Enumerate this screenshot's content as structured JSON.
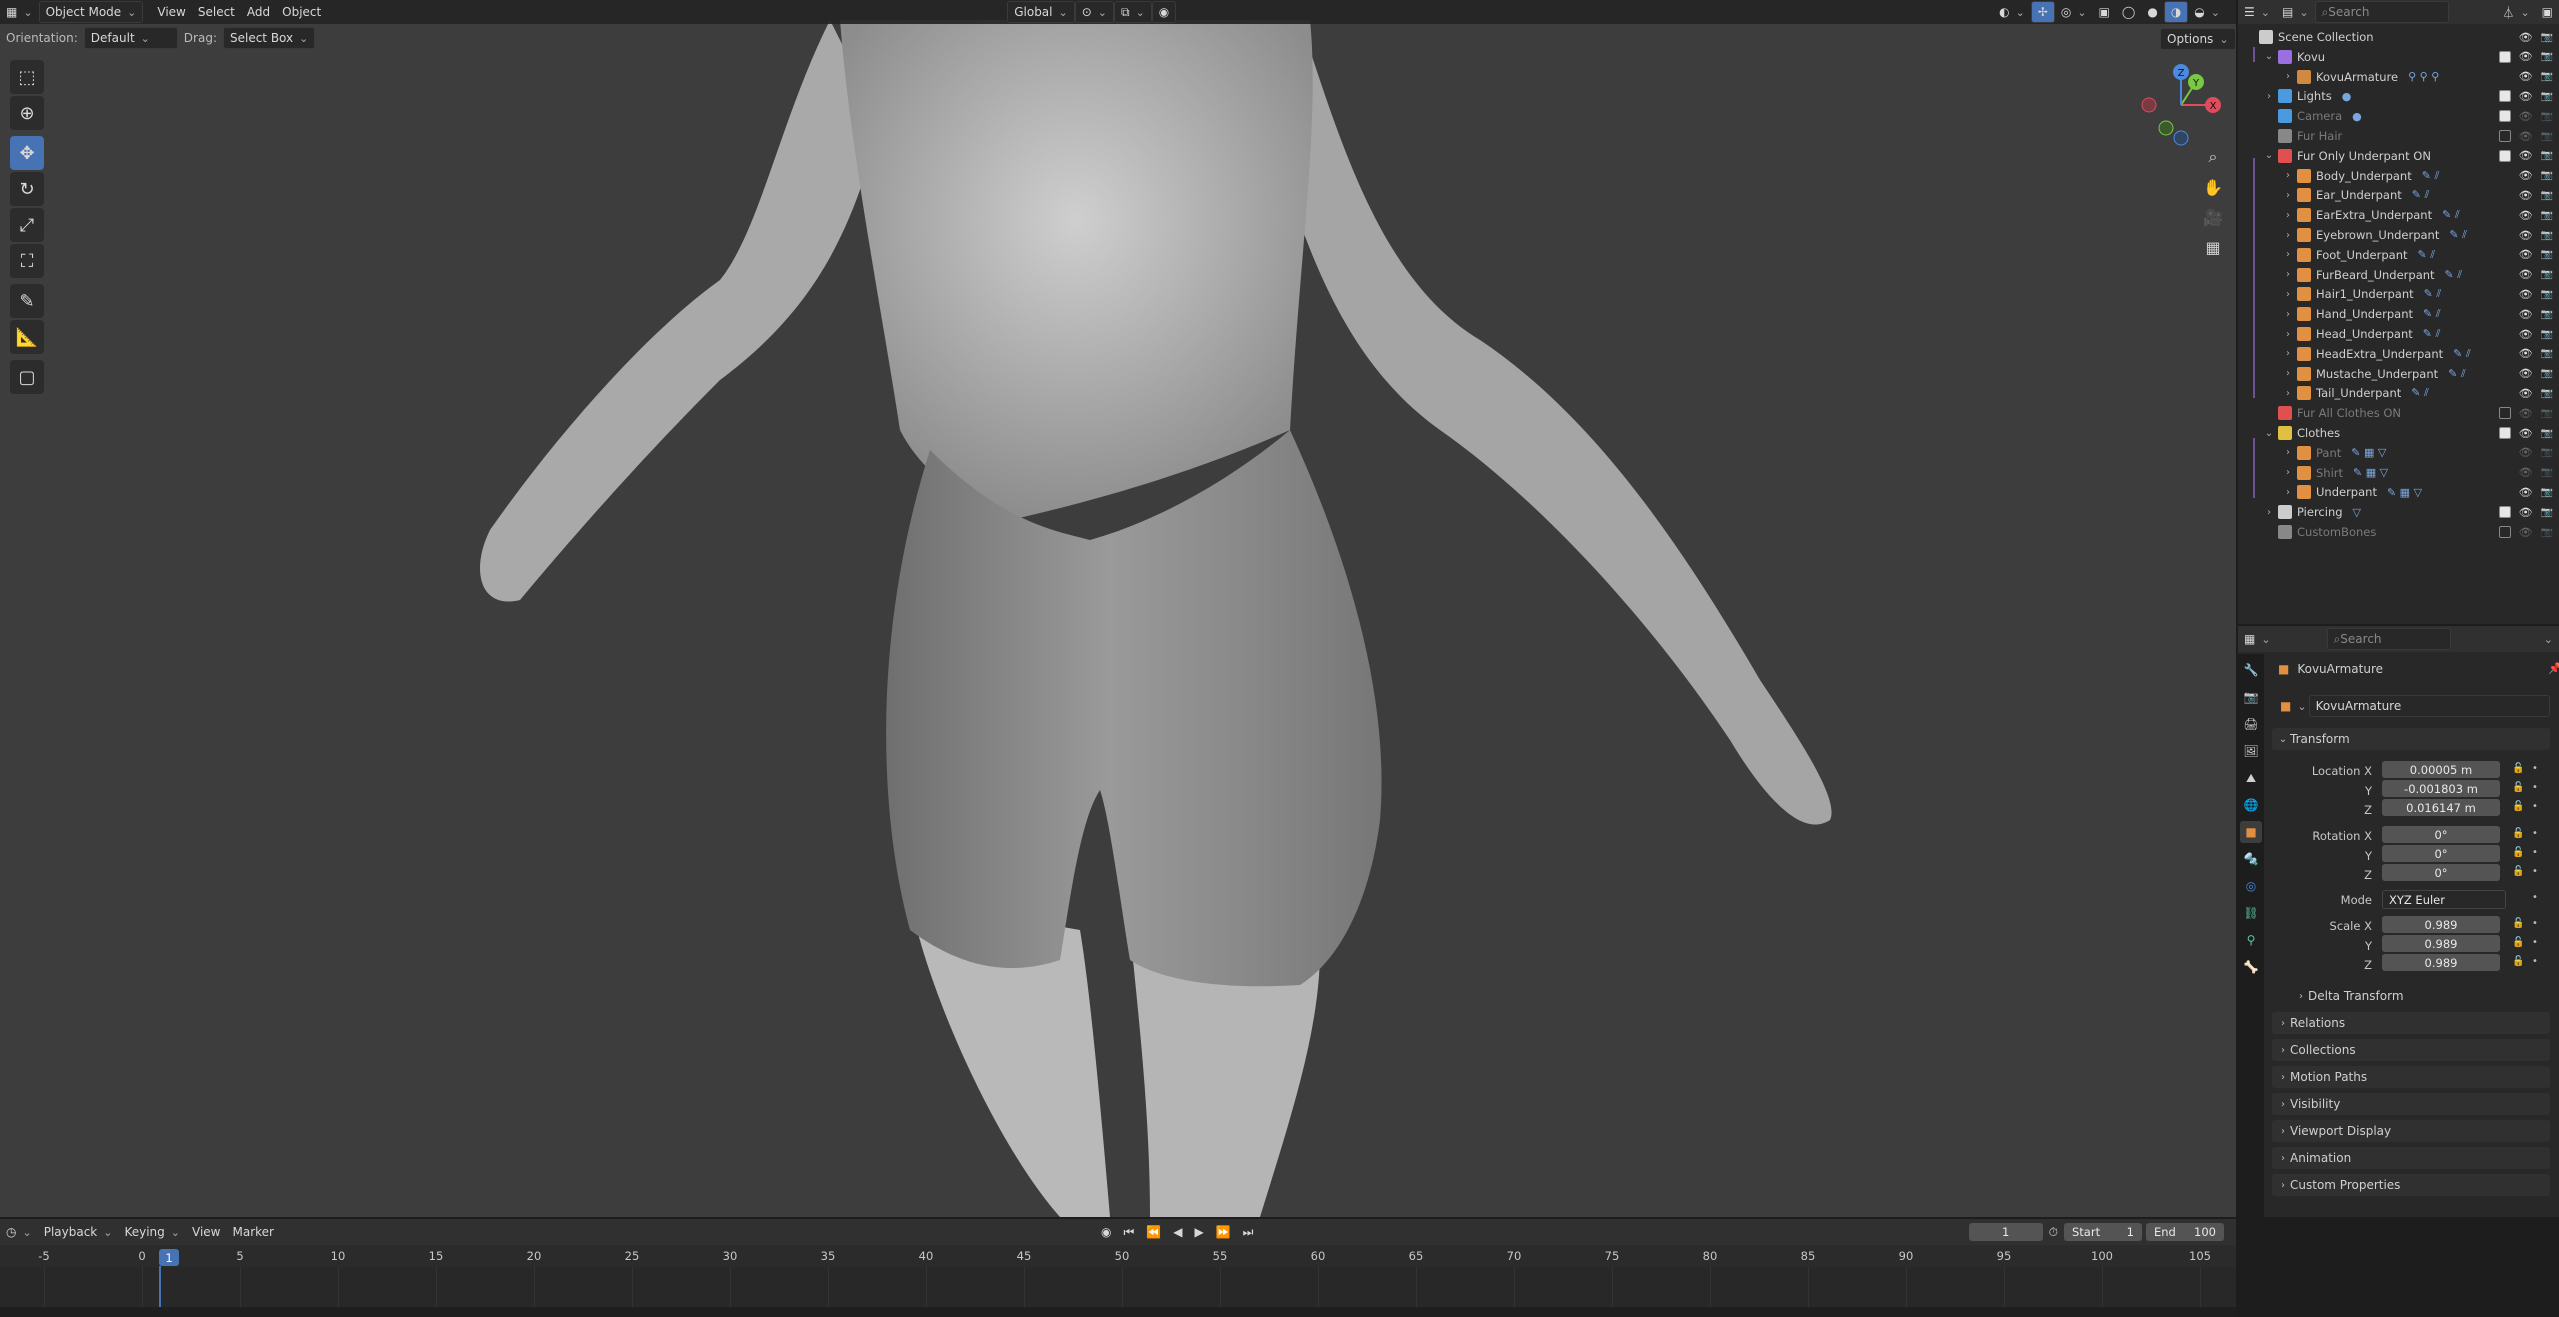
{
  "header": {
    "editor_icon": "editor-type-icon",
    "mode": "Object Mode",
    "menus": [
      "View",
      "Select",
      "Add",
      "Object"
    ],
    "transform_orientation": "Global",
    "orientation_label": "Orientation:",
    "orientation_value": "Default",
    "drag_label": "Drag:",
    "drag_value": "Select Box",
    "options_label": "Options"
  },
  "toolbar": [
    "select-box-icon",
    "cursor-icon",
    "move-icon",
    "rotate-icon",
    "scale-icon",
    "transform-icon",
    "annotate-icon",
    "measure-icon",
    "add-cube-icon"
  ],
  "gizmo": {
    "x": "X",
    "y": "Y",
    "z": "Z"
  },
  "outliner": {
    "search_placeholder": "Search",
    "rows": [
      {
        "label": "Scene Collection",
        "depth": 0,
        "icon_color": "#cccccc",
        "arrow": "",
        "checkbox": "none"
      },
      {
        "label": "Kovu",
        "depth": 1,
        "icon_color": "#9b6fe0",
        "arrow": "⌄",
        "checkbox": "on"
      },
      {
        "label": "KovuArmature",
        "depth": 2,
        "icon_color": "#d08a40",
        "arrow": "›",
        "checkbox": "none",
        "extra": "⚲ ⚲ ⚲"
      },
      {
        "label": "Lights",
        "depth": 1,
        "icon_color": "#4a9ae0",
        "arrow": "›",
        "checkbox": "on",
        "extra": "●"
      },
      {
        "label": "Camera",
        "depth": 1,
        "icon_color": "#4a9ae0",
        "arrow": "",
        "checkbox": "on",
        "extra": "●",
        "dim": true
      },
      {
        "label": "Fur Hair",
        "depth": 1,
        "icon_color": "#888888",
        "arrow": "",
        "checkbox": "off",
        "dim": true
      },
      {
        "label": "Fur Only Underpant ON",
        "depth": 1,
        "icon_color": "#e05050",
        "arrow": "⌄",
        "checkbox": "on"
      },
      {
        "label": "Body_Underpant",
        "depth": 2,
        "icon_color": "#e09040",
        "arrow": "›",
        "checkbox": "none",
        "extra": "✎ ⫽"
      },
      {
        "label": "Ear_Underpant",
        "depth": 2,
        "icon_color": "#e09040",
        "arrow": "›",
        "checkbox": "none",
        "extra": "✎ ⫽"
      },
      {
        "label": "EarExtra_Underpant",
        "depth": 2,
        "icon_color": "#e09040",
        "arrow": "›",
        "checkbox": "none",
        "extra": "✎ ⫽"
      },
      {
        "label": "Eyebrown_Underpant",
        "depth": 2,
        "icon_color": "#e09040",
        "arrow": "›",
        "checkbox": "none",
        "extra": "✎ ⫽"
      },
      {
        "label": "Foot_Underpant",
        "depth": 2,
        "icon_color": "#e09040",
        "arrow": "›",
        "checkbox": "none",
        "extra": "✎ ⫽"
      },
      {
        "label": "FurBeard_Underpant",
        "depth": 2,
        "icon_color": "#e09040",
        "arrow": "›",
        "checkbox": "none",
        "extra": "✎ ⫽"
      },
      {
        "label": "Hair1_Underpant",
        "depth": 2,
        "icon_color": "#e09040",
        "arrow": "›",
        "checkbox": "none",
        "extra": "✎ ⫽"
      },
      {
        "label": "Hand_Underpant",
        "depth": 2,
        "icon_color": "#e09040",
        "arrow": "›",
        "checkbox": "none",
        "extra": "✎ ⫽"
      },
      {
        "label": "Head_Underpant",
        "depth": 2,
        "icon_color": "#e09040",
        "arrow": "›",
        "checkbox": "none",
        "extra": "✎ ⫽"
      },
      {
        "label": "HeadExtra_Underpant",
        "depth": 2,
        "icon_color": "#e09040",
        "arrow": "›",
        "checkbox": "none",
        "extra": "✎ ⫽"
      },
      {
        "label": "Mustache_Underpant",
        "depth": 2,
        "icon_color": "#e09040",
        "arrow": "›",
        "checkbox": "none",
        "extra": "✎ ⫽"
      },
      {
        "label": "Tail_Underpant",
        "depth": 2,
        "icon_color": "#e09040",
        "arrow": "›",
        "checkbox": "none",
        "extra": "✎ ⫽"
      },
      {
        "label": "Fur All Clothes ON",
        "depth": 1,
        "icon_color": "#e05050",
        "arrow": "",
        "checkbox": "off",
        "dim": true
      },
      {
        "label": "Clothes",
        "depth": 1,
        "icon_color": "#e0c040",
        "arrow": "⌄",
        "checkbox": "on"
      },
      {
        "label": "Pant",
        "depth": 2,
        "icon_color": "#e09040",
        "arrow": "›",
        "checkbox": "none",
        "extra": "✎ ▦ ▽",
        "dim": true
      },
      {
        "label": "Shirt",
        "depth": 2,
        "icon_color": "#e09040",
        "arrow": "›",
        "checkbox": "none",
        "extra": "✎ ▦ ▽",
        "dim": true
      },
      {
        "label": "Underpant",
        "depth": 2,
        "icon_color": "#e09040",
        "arrow": "›",
        "checkbox": "none",
        "extra": "✎ ▦ ▽"
      },
      {
        "label": "Piercing",
        "depth": 1,
        "icon_color": "#cccccc",
        "arrow": "›",
        "checkbox": "on",
        "extra": "▽"
      },
      {
        "label": "CustomBones",
        "depth": 1,
        "icon_color": "#888888",
        "arrow": "",
        "checkbox": "off",
        "dim": true
      }
    ]
  },
  "properties": {
    "search_placeholder": "Search",
    "object_name": "KovuArmature",
    "data_name": "KovuArmature",
    "transform": {
      "title": "Transform",
      "location_label": "Location X",
      "location": [
        "0.00005 m",
        "-0.001803 m",
        "0.016147 m"
      ],
      "rotation_label": "Rotation X",
      "rotation": [
        "0°",
        "0°",
        "0°"
      ],
      "mode_label": "Mode",
      "mode_value": "XYZ Euler",
      "scale_label": "Scale X",
      "scale": [
        "0.989",
        "0.989",
        "0.989"
      ],
      "y_label": "Y",
      "z_label": "Z"
    },
    "sections": [
      "Delta Transform",
      "Relations",
      "Collections",
      "Motion Paths",
      "Visibility",
      "Viewport Display",
      "Animation",
      "Custom Properties"
    ]
  },
  "timeline": {
    "menus": [
      "Playback",
      "Keying",
      "View",
      "Marker"
    ],
    "current_frame": "1",
    "start_label": "Start",
    "start_value": "1",
    "end_label": "End",
    "end_value": "100",
    "ticks": [
      "-5",
      "0",
      "5",
      "10",
      "15",
      "20",
      "25",
      "30",
      "35",
      "40",
      "45",
      "50",
      "55",
      "60",
      "65",
      "70",
      "75",
      "80",
      "85",
      "90",
      "95",
      "100",
      "105"
    ]
  }
}
